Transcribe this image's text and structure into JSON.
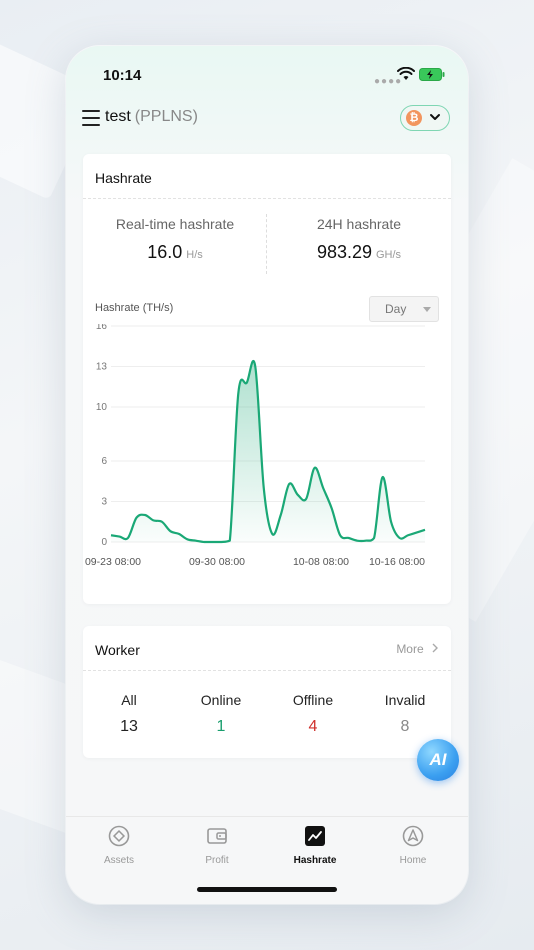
{
  "status": {
    "time": "10:14"
  },
  "header": {
    "account": "test",
    "mode": "(PPLNS)",
    "coin_icon": "bitcoin-icon"
  },
  "hashrate_card": {
    "title": "Hashrate",
    "realtime": {
      "label": "Real-time hashrate",
      "value": "16.0",
      "unit": "H/s"
    },
    "h24": {
      "label": "24H hashrate",
      "value": "983.29",
      "unit": "GH/s"
    },
    "chart_label": "Hashrate (TH/s)",
    "period": "Day"
  },
  "worker_card": {
    "title": "Worker",
    "more": "More",
    "stats": [
      {
        "label": "All",
        "value": "13",
        "color": "#222222"
      },
      {
        "label": "Online",
        "value": "1",
        "color": "#1a9e6e"
      },
      {
        "label": "Offline",
        "value": "4",
        "color": "#d0312d"
      },
      {
        "label": "Invalid",
        "value": "8",
        "color": "#888888"
      }
    ]
  },
  "ai_button": {
    "label": "AI"
  },
  "tabs": [
    {
      "label": "Assets",
      "icon": "assets-icon",
      "active": false
    },
    {
      "label": "Profit",
      "icon": "wallet-icon",
      "active": false
    },
    {
      "label": "Hashrate",
      "icon": "chart-icon",
      "active": true
    },
    {
      "label": "Home",
      "icon": "home-icon",
      "active": false
    }
  ],
  "colors": {
    "accent": "#1aa876",
    "offline": "#d0312d",
    "brand_btc": "#f2955e"
  },
  "chart_data": {
    "type": "area",
    "title": "",
    "ylabel": "Hashrate (TH/s)",
    "ylim": [
      0,
      16
    ],
    "yticks": [
      0,
      3,
      6,
      10,
      13,
      16
    ],
    "x_tick_labels": [
      "09-23 08:00",
      "09-30 08:00",
      "10-08 08:00",
      "10-16 08:00"
    ],
    "grid": true,
    "series": [
      {
        "values": [
          0.5,
          0.4,
          0.3,
          1.8,
          2.0,
          1.6,
          1.5,
          0.8,
          0.6,
          0.2,
          0.1,
          0.0,
          0.0,
          0.0,
          0.1,
          11.0,
          11.8,
          13.0,
          4.0,
          0.6,
          2.0,
          4.3,
          3.5,
          3.2,
          5.5,
          4.0,
          2.5,
          0.5,
          0.3,
          0.1,
          0.1,
          0.3,
          4.8,
          1.5,
          0.3,
          0.5,
          0.7,
          0.9
        ]
      }
    ]
  }
}
